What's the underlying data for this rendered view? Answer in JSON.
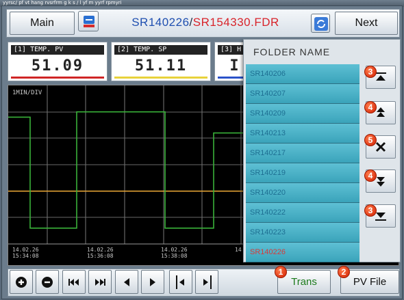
{
  "top_strip": "yyrsc/ pf vt hang rvsrfrm g   k  s / l yf m yyrf rpmyri",
  "header": {
    "main_label": "Main",
    "next_label": "Next",
    "title_folder": "SR140226",
    "title_sep": "/",
    "title_file": "SR154330.FDR",
    "sd_icon": "sd-card-icon",
    "refresh_icon": "refresh-icon"
  },
  "tiles": [
    {
      "label": "[1] TEMP. PV",
      "value": "51.09",
      "color": "#d02525"
    },
    {
      "label": "[2] TEMP. SP",
      "value": "51.11",
      "color": "#e8d23a"
    },
    {
      "label": "[3] H",
      "value": "I",
      "color": "#2a52c9"
    }
  ],
  "chart": {
    "div_label": "1MIN/DIV",
    "time_labels": [
      "14.02.26\n15:34:08",
      "14.02.26\n15:36:08",
      "14.02.26\n15:38:08",
      "14"
    ]
  },
  "chart_data": {
    "type": "line",
    "xlabel": "",
    "ylabel": "",
    "series": [
      {
        "values": [
          1,
          1,
          1,
          1,
          1,
          1,
          1
        ]
      },
      {
        "values": [
          1,
          1,
          1,
          1,
          1,
          1,
          1
        ]
      },
      {
        "values": [
          2.4,
          0.3,
          2.5,
          2.5,
          0.3,
          0.3,
          2.1
        ]
      }
    ]
  },
  "panel": {
    "title": "FOLDER NAME",
    "folders": [
      "SR140206",
      "SR140207",
      "SR140209",
      "SR140213",
      "SR140217",
      "SR140219",
      "SR140220",
      "SR140222",
      "SR140223",
      "SR140226"
    ],
    "selected": "SR140226",
    "buttons": [
      {
        "name": "first-page",
        "glyph": "⤒",
        "badge": "3"
      },
      {
        "name": "page-up",
        "glyph": "⏫",
        "badge": "4"
      },
      {
        "name": "delete",
        "glyph": "✕",
        "badge": "5"
      },
      {
        "name": "page-down",
        "glyph": "⏬",
        "badge": "4"
      },
      {
        "name": "last-page",
        "glyph": "⤓",
        "badge": "3"
      }
    ]
  },
  "bottom": {
    "buttons": [
      {
        "name": "zoom-in-button",
        "glyph": "⊕"
      },
      {
        "name": "zoom-out-button",
        "glyph": "⊖"
      },
      {
        "name": "first-button",
        "glyph": "⏮"
      },
      {
        "name": "last-button",
        "glyph": "⏭"
      },
      {
        "name": "prev-button",
        "glyph": "◀"
      },
      {
        "name": "next-step-button",
        "glyph": "▶"
      },
      {
        "name": "cursor-left-button",
        "glyph": "|◀"
      },
      {
        "name": "cursor-right-button",
        "glyph": "▶|"
      }
    ],
    "trans_label": "Trans",
    "trans_badge": "1",
    "pvfile_label": "PV File",
    "pvfile_badge": "2"
  }
}
